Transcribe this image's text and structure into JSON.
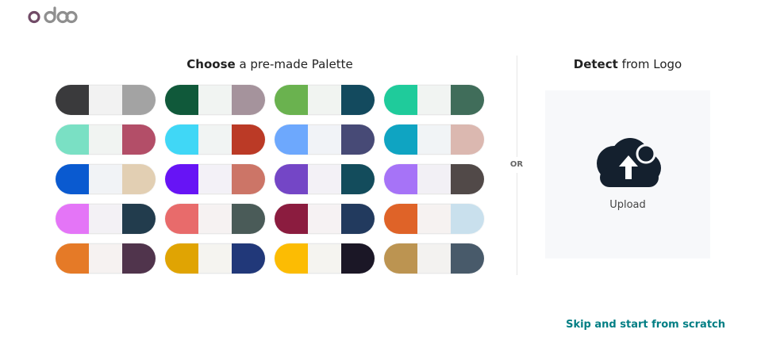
{
  "brand": {
    "logo_text": "odoo"
  },
  "left": {
    "title_bold": "Choose",
    "title_rest": " a pre-made Palette",
    "palettes": [
      [
        "#3a3a3c",
        "#f2f2f2",
        "#a3a3a3"
      ],
      [
        "#10593a",
        "#f1f4f2",
        "#a5939c"
      ],
      [
        "#6ab24f",
        "#f1f4f1",
        "#134a5e"
      ],
      [
        "#1fcb9b",
        "#f1f4f2",
        "#406d5a"
      ],
      [
        "#7ae0c4",
        "#f1f4f2",
        "#b34e68"
      ],
      [
        "#40d7f6",
        "#f1f4f3",
        "#bb3a26"
      ],
      [
        "#6da8fd",
        "#f1f3f7",
        "#474a76"
      ],
      [
        "#0fa4c2",
        "#f1f4f6",
        "#dbb8b0"
      ],
      [
        "#0a5ad0",
        "#f1f3f6",
        "#e2cfb3"
      ],
      [
        "#6714f5",
        "#f3f1f7",
        "#cc7567"
      ],
      [
        "#7446c6",
        "#f3f1f6",
        "#134c5c"
      ],
      [
        "#a673f7",
        "#f2f0f5",
        "#514948"
      ],
      [
        "#e475f7",
        "#f3f1f5",
        "#223c4d"
      ],
      [
        "#e86b6b",
        "#f6f2f2",
        "#4a5b58"
      ],
      [
        "#8b1c3f",
        "#f6f2f3",
        "#223a5e"
      ],
      [
        "#df6328",
        "#f6f2f1",
        "#c9e0ed"
      ],
      [
        "#e57a27",
        "#f6f2f1",
        "#50344c"
      ],
      [
        "#e0a403",
        "#f5f4f0",
        "#213879"
      ],
      [
        "#fcbc03",
        "#f5f4f0",
        "#1b1726"
      ],
      [
        "#bc9451",
        "#f3f2f0",
        "#485a6a"
      ]
    ]
  },
  "divider": {
    "or_label": "OR"
  },
  "right": {
    "title_bold": "Detect",
    "title_rest": " from Logo",
    "upload_label": "Upload",
    "upload_icon": "cloud-upload-icon"
  },
  "footer": {
    "skip_label": "Skip and start from scratch"
  },
  "colors": {
    "accent": "#017e84",
    "logo": "#714b67",
    "icon": "#14202e"
  }
}
